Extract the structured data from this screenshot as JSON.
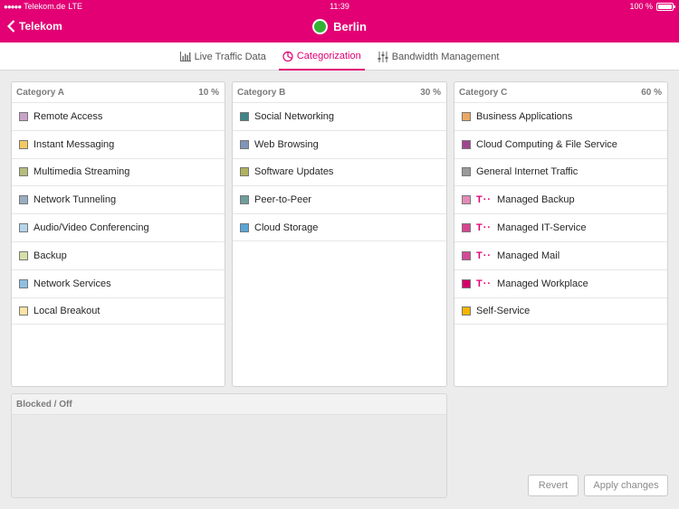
{
  "status_bar": {
    "carrier": "Telekom.de",
    "network": "LTE",
    "time": "11:39",
    "battery": "100 %",
    "battery_level": 1.0
  },
  "header": {
    "back_label": "Telekom",
    "title": "Berlin",
    "status_color": "#34b233",
    "brand_color": "#e20074"
  },
  "tabs": [
    {
      "label": "Live Traffic Data",
      "icon": "bar-chart-icon",
      "active": false
    },
    {
      "label": "Categorization",
      "icon": "pie-chart-icon",
      "active": true
    },
    {
      "label": "Bandwidth Management",
      "icon": "sliders-icon",
      "active": false
    }
  ],
  "categories": [
    {
      "title": "Category A",
      "percent": "10 %",
      "items": [
        {
          "label": "Remote Access",
          "color": "#c8a2c8"
        },
        {
          "label": "Instant Messaging",
          "color": "#f4c862"
        },
        {
          "label": "Multimedia Streaming",
          "color": "#b6bd7c"
        },
        {
          "label": "Network Tunneling",
          "color": "#9aacc2"
        },
        {
          "label": "Audio/Video Conferencing",
          "color": "#b6d5ec"
        },
        {
          "label": "Backup",
          "color": "#d7dfa6"
        },
        {
          "label": "Network Services",
          "color": "#8ec0e4"
        },
        {
          "label": "Local Breakout",
          "color": "#fbe3a6"
        }
      ]
    },
    {
      "title": "Category B",
      "percent": "30 %",
      "items": [
        {
          "label": "Social Networking",
          "color": "#3f8587"
        },
        {
          "label": "Web Browsing",
          "color": "#7e96b8"
        },
        {
          "label": "Software Updates",
          "color": "#b0b25e"
        },
        {
          "label": "Peer-to-Peer",
          "color": "#6f9d9e"
        },
        {
          "label": "Cloud Storage",
          "color": "#58a6d8"
        }
      ]
    },
    {
      "title": "Category C",
      "percent": "60 %",
      "items": [
        {
          "label": "Business Applications",
          "color": "#eba862",
          "telekom": false
        },
        {
          "label": "Cloud Computing & File Service",
          "color": "#a04590",
          "telekom": false
        },
        {
          "label": "General Internet Traffic",
          "color": "#9a9a9a",
          "telekom": false
        },
        {
          "label": "Managed Backup",
          "color": "#e38bb9",
          "telekom": true
        },
        {
          "label": "Managed IT-Service",
          "color": "#d8448f",
          "telekom": true
        },
        {
          "label": "Managed Mail",
          "color": "#d44a98",
          "telekom": true
        },
        {
          "label": "Managed Workplace",
          "color": "#d6006a",
          "telekom": true
        },
        {
          "label": "Self-Service",
          "color": "#f4b400",
          "telekom": false
        }
      ]
    }
  ],
  "blocked": {
    "title": "Blocked / Off"
  },
  "telekom_mark": "T··",
  "buttons": {
    "revert": "Revert",
    "apply": "Apply changes"
  }
}
